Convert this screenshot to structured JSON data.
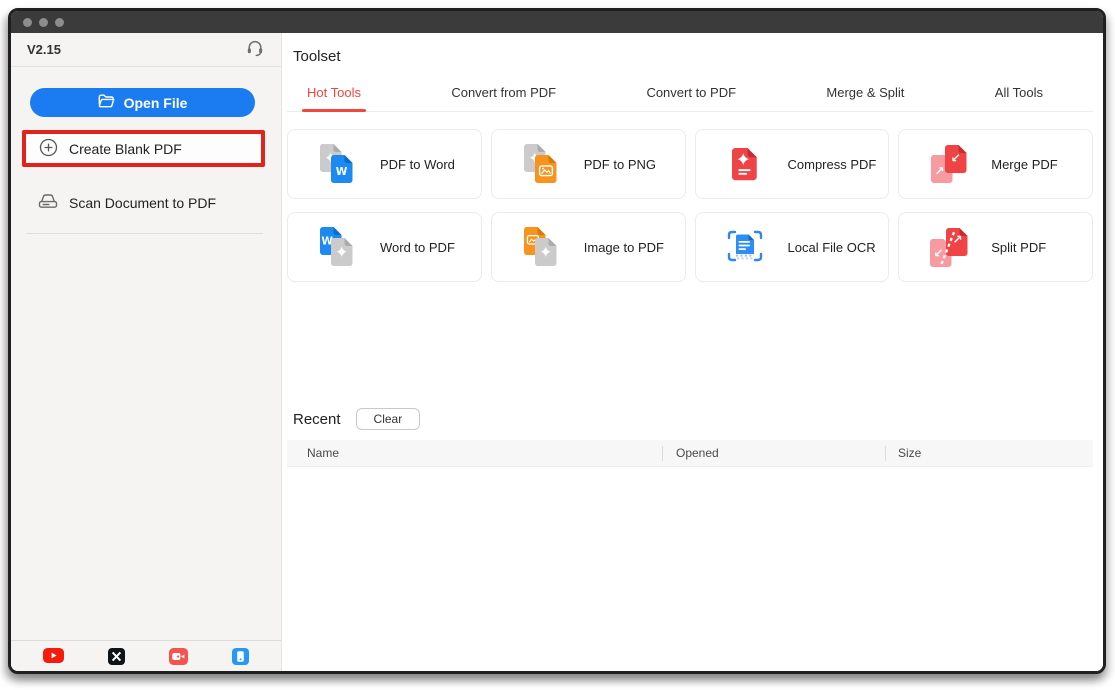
{
  "window": {
    "version": "V2.15",
    "traffic_lights": [
      "close",
      "minimize",
      "zoom"
    ]
  },
  "sidebar": {
    "open_file_label": "Open File",
    "create_blank_pdf_label": "Create Blank PDF",
    "scan_document_label": "Scan Document to PDF",
    "social_icons": [
      "youtube",
      "x-twitter",
      "video-channel",
      "mobile-app"
    ]
  },
  "toolset": {
    "title": "Toolset",
    "tabs": [
      {
        "label": "Hot Tools",
        "active": true
      },
      {
        "label": "Convert from PDF",
        "active": false
      },
      {
        "label": "Convert to PDF",
        "active": false
      },
      {
        "label": "Merge & Split",
        "active": false
      },
      {
        "label": "All Tools",
        "active": false
      }
    ],
    "tools": [
      {
        "label": "PDF to Word",
        "icon": "pdf-to-word-icon"
      },
      {
        "label": "PDF to PNG",
        "icon": "pdf-to-png-icon"
      },
      {
        "label": "Compress PDF",
        "icon": "compress-pdf-icon"
      },
      {
        "label": "Merge PDF",
        "icon": "merge-pdf-icon"
      },
      {
        "label": "Word to PDF",
        "icon": "word-to-pdf-icon"
      },
      {
        "label": "Image to PDF",
        "icon": "image-to-pdf-icon"
      },
      {
        "label": "Local File OCR",
        "icon": "local-file-ocr-icon"
      },
      {
        "label": "Split PDF",
        "icon": "split-pdf-icon"
      }
    ]
  },
  "recent": {
    "title": "Recent",
    "clear_label": "Clear",
    "columns": [
      "Name",
      "Opened",
      "Size"
    ],
    "rows": []
  },
  "annotation": {
    "highlight_target": "Create Blank PDF",
    "color": "#e1221d"
  },
  "colors": {
    "accent_blue": "#1b7cf2",
    "active_tab_red": "#f2453d",
    "annotation_red": "#e1221d",
    "sidebar_bg": "#f5f4f2",
    "titlebar_bg": "#3b3b3b",
    "doc_gray": "#cbcbcb",
    "doc_blue": "#1d8af2",
    "doc_orange": "#f8941d",
    "doc_red": "#ef4345",
    "doc_pink": "#f79ba1"
  }
}
